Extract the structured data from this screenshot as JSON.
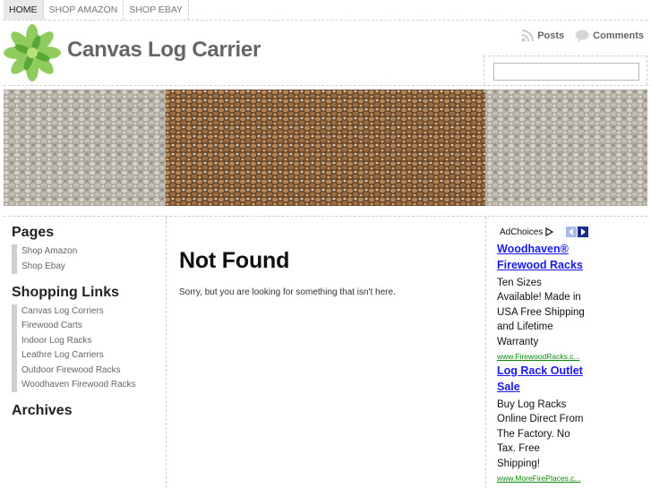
{
  "nav": {
    "items": [
      {
        "label": "HOME",
        "active": true
      },
      {
        "label": "SHOP AMAZON",
        "active": false
      },
      {
        "label": "SHOP EBAY",
        "active": false
      }
    ]
  },
  "header": {
    "logo_icon": "green-leaf-flower-logo",
    "site_title": "Canvas Log Carrier",
    "feeds": {
      "posts_label": "Posts",
      "comments_label": "Comments",
      "posts_icon": "rss-icon",
      "comments_icon": "speech-bubble-icon"
    },
    "search": {
      "value": "",
      "placeholder": ""
    }
  },
  "banner": {
    "icon": "stacked-firewood-image"
  },
  "sidebar": {
    "pages_heading": "Pages",
    "pages": [
      "Shop Amazon",
      "Shop Ebay"
    ],
    "shopping_heading": "Shopping Links",
    "shopping_links": [
      "Canvas Log Corriers",
      "Firewood Carts",
      "Indoor Log Racks",
      "Leathre Log Carriers",
      "Outdoor Firewood Racks",
      "Woodhaven Firewood Racks"
    ],
    "archives_heading": "Archives"
  },
  "main": {
    "title": "Not Found",
    "message": "Sorry, but you are looking for something that isn't here."
  },
  "ads": {
    "adchoices_label": "AdChoices",
    "items": [
      {
        "title_line1": "Woodhaven®",
        "title_line2": "Firewood Racks",
        "body": [
          "Ten Sizes",
          "Available! Made in",
          "USA Free Shipping",
          "and Lifetime",
          "Warranty"
        ],
        "url": "www.FirewoodRacks.c..."
      },
      {
        "title_line1": "Log Rack Outlet",
        "title_line2": "Sale",
        "body": [
          "Buy Log Racks",
          "Online Direct From",
          "The Factory. No",
          "Tax. Free",
          "Shipping!"
        ],
        "url": "www.MoreFirePlaces.c..."
      }
    ]
  },
  "colors": {
    "title_gray": "#666666",
    "ad_link": "#1a1aee",
    "ad_url": "#0a8a0a",
    "rule": "#cfcfcf"
  }
}
